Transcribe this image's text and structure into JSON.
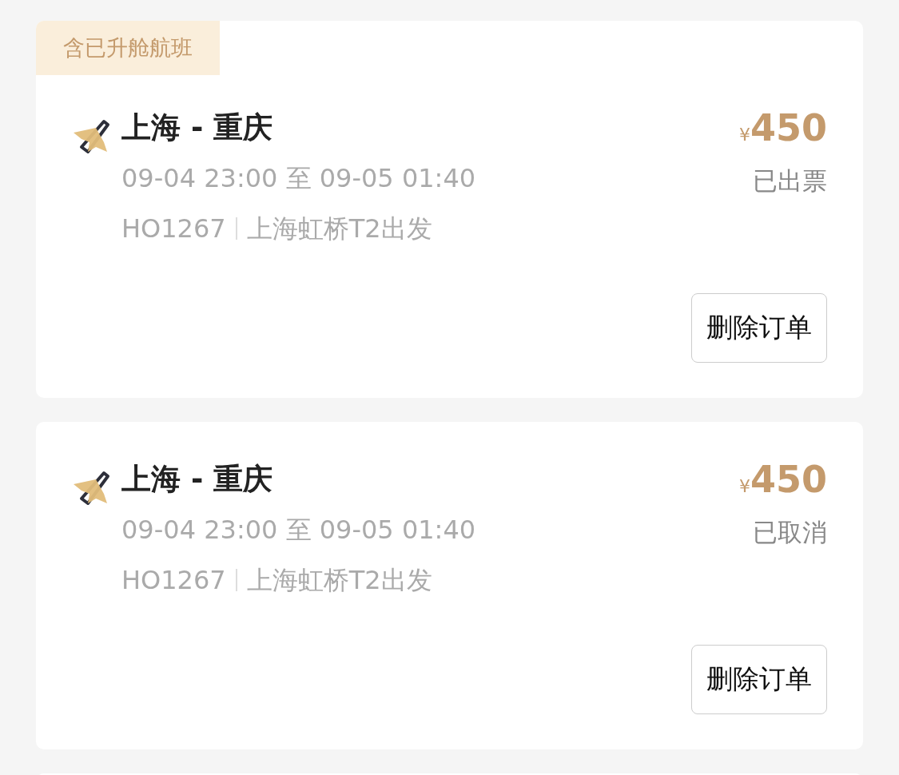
{
  "orders": [
    {
      "tag": "含已升舱航班",
      "route": "上海 - 重庆",
      "time": "09-04 23:00 至 09-05 01:40",
      "flight": "HO1267",
      "departure": "上海虹桥T2出发",
      "currency": "¥",
      "price": "450",
      "status": "已出票",
      "action": "删除订单"
    },
    {
      "route": "上海 - 重庆",
      "time": "09-04 23:00 至 09-05 01:40",
      "flight": "HO1267",
      "departure": "上海虹桥T2出发",
      "currency": "¥",
      "price": "450",
      "status": "已取消",
      "action": "删除订单"
    }
  ]
}
